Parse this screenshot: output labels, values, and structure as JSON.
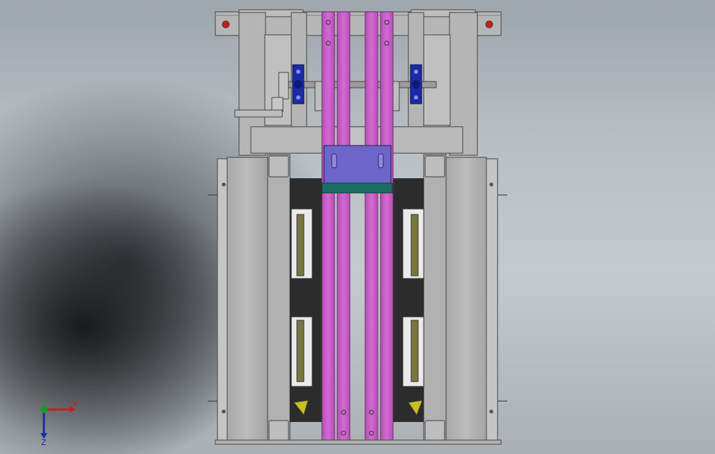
{
  "triad": {
    "x_label": "X",
    "y_label": "Y",
    "z_label": "Z"
  },
  "colors": {
    "viewport_top": "#9ea6ad",
    "viewport_dark": "#1a1c1e",
    "frame_gray": "#b3b3b3",
    "frame_edge": "#5a5a5a",
    "rail_magenta": "#cc5fcc",
    "bearing_blue": "#1a2ba8",
    "block_violet": "#6d66c8",
    "base_teal": "#1c6e62",
    "pad_olive": "#7a7640",
    "marker_red": "#cc1b1b",
    "cam_yellow": "#c8c020"
  }
}
